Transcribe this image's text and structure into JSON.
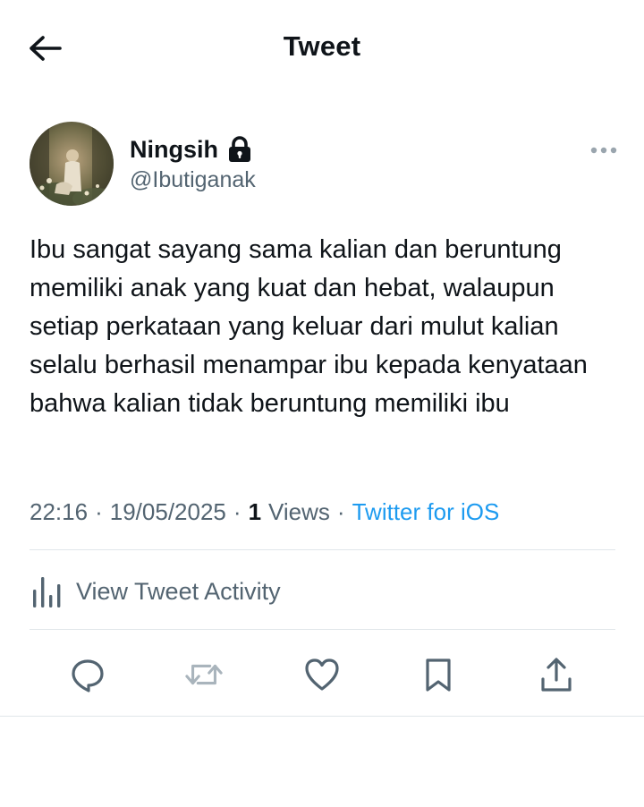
{
  "header": {
    "title": "Tweet",
    "back_icon": "arrow-left-icon"
  },
  "author": {
    "display_name": "Ningsih",
    "handle": "@Ibutiganak",
    "protected_icon": "lock-icon",
    "avatar_icon": "avatar-photo"
  },
  "tweet": {
    "text": "Ibu sangat sayang sama kalian dan beruntung memiliki anak yang kuat dan hebat, walaupun setiap perkataan yang keluar dari mulut kalian selalu berhasil menampar ibu kepada kenyataan bahwa kalian tidak beruntung memiliki ibu",
    "time": "22:16",
    "date": "19/05/2025",
    "separator": "·",
    "views_count": "1",
    "views_label": "Views",
    "source": "Twitter for iOS"
  },
  "activity": {
    "label": "View Tweet Activity",
    "icon": "analytics-bars-icon"
  },
  "actions": [
    {
      "name": "reply",
      "icon": "reply-bubble-icon"
    },
    {
      "name": "retweet",
      "icon": "retweet-icon"
    },
    {
      "name": "like",
      "icon": "heart-icon"
    },
    {
      "name": "bookmark",
      "icon": "bookmark-icon"
    },
    {
      "name": "share",
      "icon": "share-upload-icon"
    }
  ],
  "colors": {
    "text_primary": "#0f1419",
    "text_secondary": "#536471",
    "link": "#1d9bf0",
    "divider": "#e1e6ea",
    "background": "#ffffff"
  }
}
